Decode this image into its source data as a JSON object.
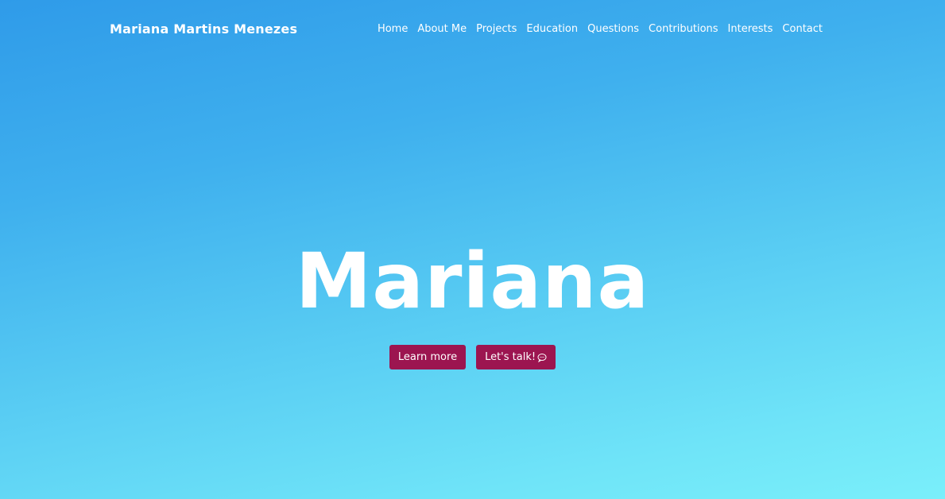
{
  "navbar": {
    "brand": "Mariana Martins Menezes",
    "links": [
      {
        "label": "Home"
      },
      {
        "label": "About Me"
      },
      {
        "label": "Projects"
      },
      {
        "label": "Education"
      },
      {
        "label": "Questions"
      },
      {
        "label": "Contributions"
      },
      {
        "label": "Interests"
      },
      {
        "label": "Contact"
      }
    ]
  },
  "hero": {
    "title": "Mariana",
    "buttons": {
      "learn_more": "Learn more",
      "lets_talk": "Let's talk!",
      "lets_talk_icon": "chat-bubble-icon"
    }
  },
  "colors": {
    "gradient_top": "#2f9be9",
    "gradient_bottom": "#7aeffa",
    "button_bg": "#9c1550",
    "text": "#ffffff"
  }
}
